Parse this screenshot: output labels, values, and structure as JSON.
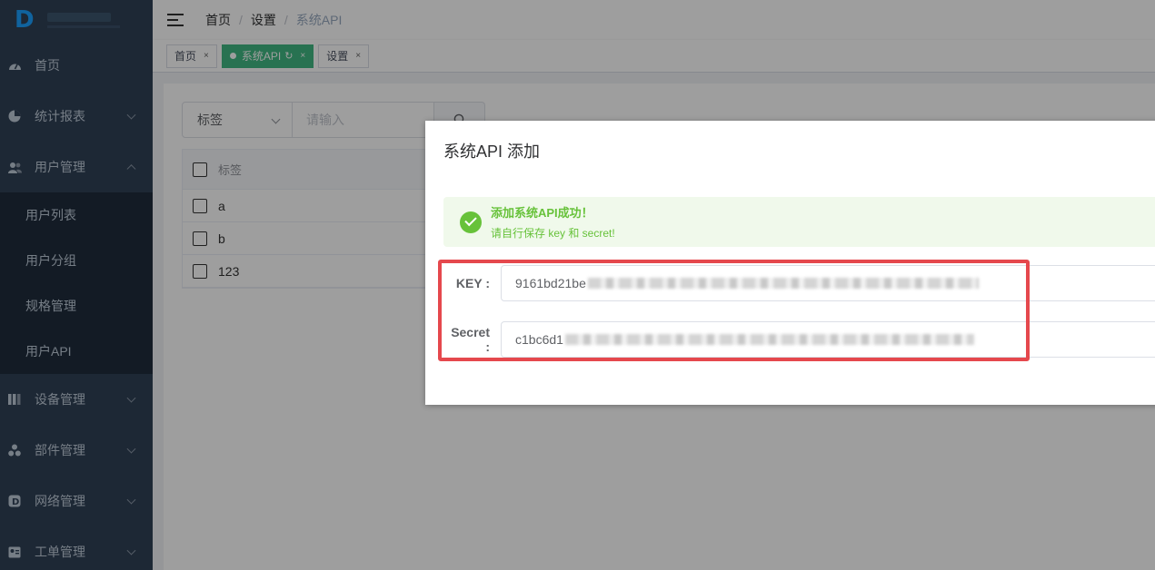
{
  "sidebar": {
    "menu": [
      {
        "label": "首页",
        "icon": "dashboard-icon"
      },
      {
        "label": "统计报表",
        "icon": "pie-chart-icon"
      },
      {
        "label": "用户管理",
        "icon": "users-icon"
      }
    ],
    "submenu": [
      "用户列表",
      "用户分组",
      "规格管理",
      "用户API"
    ],
    "menu_after": [
      {
        "label": "设备管理",
        "icon": "books-icon"
      },
      {
        "label": "部件管理",
        "icon": "components-icon"
      },
      {
        "label": "网络管理",
        "icon": "network-icon"
      },
      {
        "label": "工单管理",
        "icon": "ticket-icon"
      }
    ]
  },
  "topbar": {
    "breadcrumb": [
      "首页",
      "设置",
      "系统API"
    ],
    "separator": "/"
  },
  "tags": [
    {
      "label": "首页",
      "close": "×"
    },
    {
      "label": "系统API",
      "close": "×",
      "refresh": "↻",
      "active": true
    },
    {
      "label": "设置",
      "close": "×"
    }
  ],
  "search": {
    "select_value": "标签",
    "placeholder": "请输入"
  },
  "table": {
    "header": "标签",
    "rows": [
      "a",
      "b",
      "123"
    ]
  },
  "dialog": {
    "title": "系统API 添加",
    "alert_title": "添加系统API成功！",
    "alert_desc": "请自行保存 key 和 secret!",
    "key_label": "KEY :",
    "key_value": "9161bd21be",
    "secret_label": "Secret :",
    "secret_value": "c1bc6d1"
  },
  "colors": {
    "sidebar_bg": "#304156",
    "active_tag": "#42b983",
    "success": "#67c23a",
    "highlight_border": "#e5484d"
  }
}
